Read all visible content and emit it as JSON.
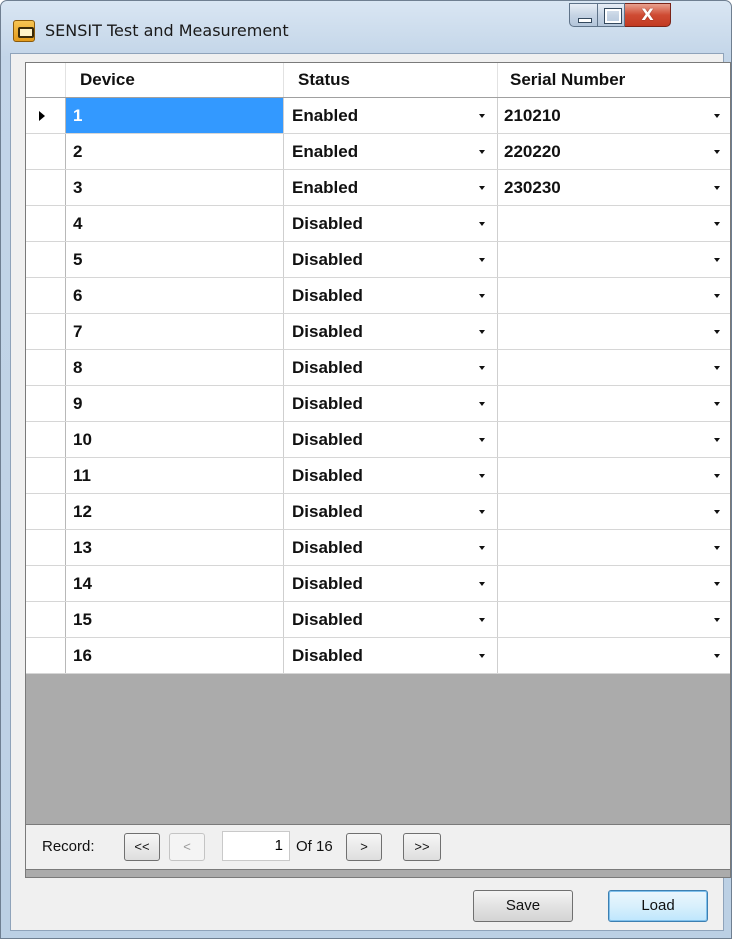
{
  "window": {
    "title": "SENSIT Test and Measurement",
    "controls": {
      "minimize": "minimize",
      "maximize": "maximize",
      "close": "X"
    }
  },
  "grid": {
    "columns": [
      "Device",
      "Status",
      "Serial Number"
    ],
    "selected_row": 0,
    "rows": [
      {
        "device": "1",
        "status": "Enabled",
        "serial": "210210"
      },
      {
        "device": "2",
        "status": "Enabled",
        "serial": "220220"
      },
      {
        "device": "3",
        "status": "Enabled",
        "serial": "230230"
      },
      {
        "device": "4",
        "status": "Disabled",
        "serial": ""
      },
      {
        "device": "5",
        "status": "Disabled",
        "serial": ""
      },
      {
        "device": "6",
        "status": "Disabled",
        "serial": ""
      },
      {
        "device": "7",
        "status": "Disabled",
        "serial": ""
      },
      {
        "device": "8",
        "status": "Disabled",
        "serial": ""
      },
      {
        "device": "9",
        "status": "Disabled",
        "serial": ""
      },
      {
        "device": "10",
        "status": "Disabled",
        "serial": ""
      },
      {
        "device": "11",
        "status": "Disabled",
        "serial": ""
      },
      {
        "device": "12",
        "status": "Disabled",
        "serial": ""
      },
      {
        "device": "13",
        "status": "Disabled",
        "serial": ""
      },
      {
        "device": "14",
        "status": "Disabled",
        "serial": ""
      },
      {
        "device": "15",
        "status": "Disabled",
        "serial": ""
      },
      {
        "device": "16",
        "status": "Disabled",
        "serial": ""
      }
    ]
  },
  "navigator": {
    "label": "Record:",
    "first": "<<",
    "prev": "<",
    "current": "1",
    "of_text": "Of 16",
    "next": ">",
    "last": ">>"
  },
  "buttons": {
    "save": "Save",
    "load": "Load"
  },
  "colors": {
    "selection": "#3399ff",
    "grid_empty": "#ababab"
  }
}
